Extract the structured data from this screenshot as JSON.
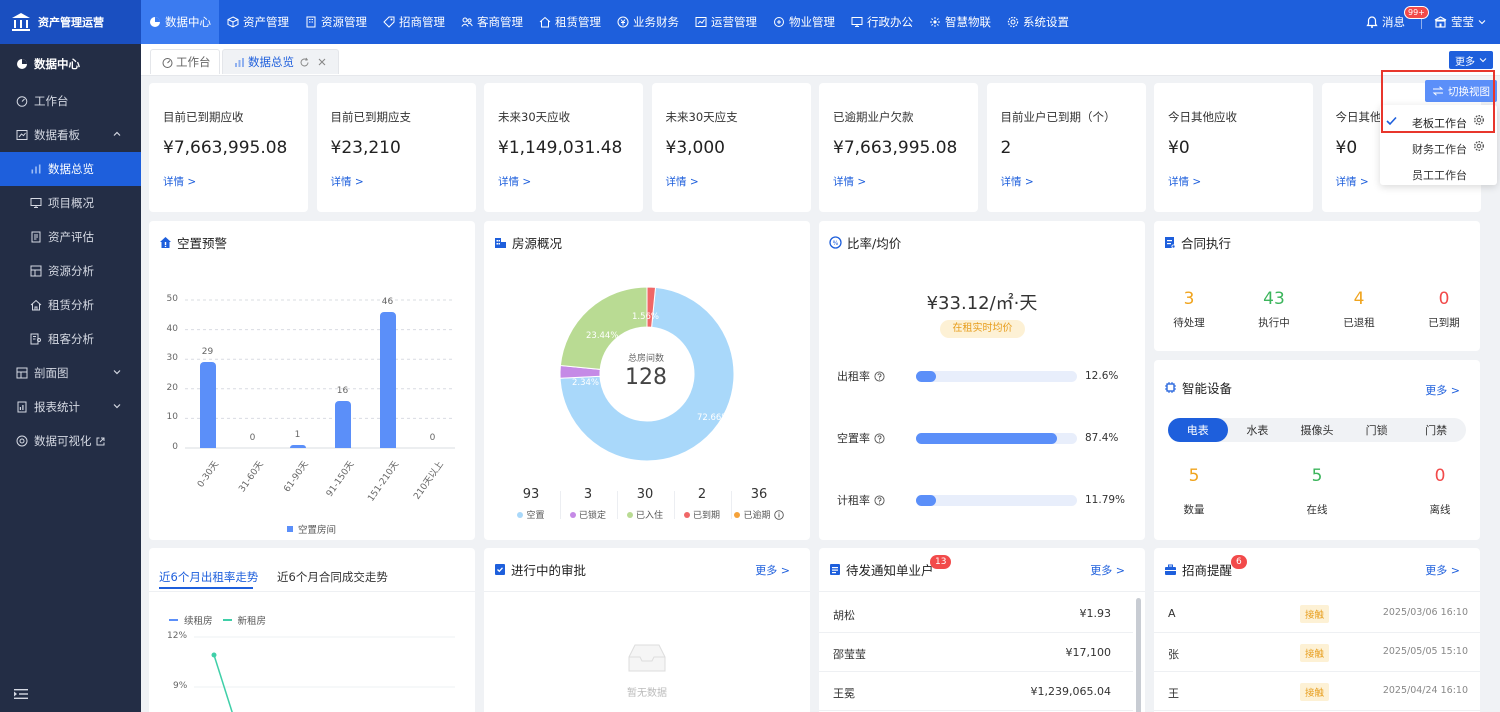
{
  "app": {
    "title": "资产管理运营"
  },
  "topnav": [
    {
      "label": "数据中心",
      "active": true,
      "icon": "pie-icon"
    },
    {
      "label": "资产管理",
      "icon": "cube-icon"
    },
    {
      "label": "资源管理",
      "icon": "building-icon"
    },
    {
      "label": "招商管理",
      "icon": "tag-icon"
    },
    {
      "label": "客商管理",
      "icon": "people-icon"
    },
    {
      "label": "租赁管理",
      "icon": "home-icon"
    },
    {
      "label": "业务财务",
      "icon": "coin-icon"
    },
    {
      "label": "运营管理",
      "icon": "chart-icon"
    },
    {
      "label": "物业管理",
      "icon": "tools-icon"
    },
    {
      "label": "行政办公",
      "icon": "monitor-icon"
    },
    {
      "label": "智慧物联",
      "icon": "iot-icon"
    },
    {
      "label": "系统设置",
      "icon": "gear-icon"
    }
  ],
  "header": {
    "messages_label": "消息",
    "messages_badge": "99+",
    "user_name": "莹莹"
  },
  "sidebar": {
    "section": "数据中心",
    "items": [
      {
        "label": "工作台",
        "icon": "dashboard-icon"
      },
      {
        "label": "数据看板",
        "icon": "board-icon",
        "expanded": true,
        "children": [
          {
            "label": "数据总览",
            "active": true,
            "icon": "bar-chart-icon"
          },
          {
            "label": "项目概况",
            "icon": "monitor-icon"
          },
          {
            "label": "资产评估",
            "icon": "doc-icon"
          },
          {
            "label": "资源分析",
            "icon": "layers-icon"
          },
          {
            "label": "租赁分析",
            "icon": "house-icon"
          },
          {
            "label": "租客分析",
            "icon": "person-doc-icon"
          }
        ]
      },
      {
        "label": "剖面图",
        "icon": "layers-icon",
        "caret": "down"
      },
      {
        "label": "报表统计",
        "icon": "report-icon",
        "caret": "down"
      },
      {
        "label": "数据可视化",
        "icon": "visual-icon",
        "external": true
      }
    ]
  },
  "tabs": [
    {
      "label": "工作台",
      "active": false
    },
    {
      "label": "数据总览",
      "active": true
    }
  ],
  "more_label": "更多",
  "stats": [
    {
      "label": "目前已到期应收",
      "value": "¥7,663,995.08",
      "link": "详情 >"
    },
    {
      "label": "目前已到期应支",
      "value": "¥23,210",
      "link": "详情 >"
    },
    {
      "label": "未来30天应收",
      "value": "¥1,149,031.48",
      "link": "详情 >"
    },
    {
      "label": "未来30天应支",
      "value": "¥3,000",
      "link": "详情 >"
    },
    {
      "label": "已逾期业户欠款",
      "value": "¥7,663,995.08",
      "link": "详情 >"
    },
    {
      "label": "目前业户已到期（个）",
      "value": "2",
      "link": "详情 >"
    },
    {
      "label": "今日其他应收",
      "value": "¥0",
      "link": "详情 >"
    },
    {
      "label": "今日其他",
      "value": "¥0",
      "link": "详情 >"
    }
  ],
  "vacancy": {
    "title": "空置预警",
    "legend": "空置房间",
    "chart_data": {
      "type": "bar",
      "categories": [
        "0-30天",
        "31-60天",
        "61-90天",
        "91-150天",
        "151-210天",
        "210天以上"
      ],
      "values": [
        29,
        0,
        1,
        16,
        46,
        0
      ],
      "ylim": [
        0,
        50
      ],
      "yticks": [
        0,
        10,
        20,
        30,
        40,
        50
      ],
      "grid": true,
      "legend_position": "bottom",
      "series": [
        {
          "name": "空置房间",
          "values": [
            29,
            0,
            1,
            16,
            46,
            0
          ]
        }
      ]
    }
  },
  "housing": {
    "title": "房源概况",
    "center_label": "总房间数",
    "center_value": "128",
    "chart_data": {
      "type": "pie",
      "categories": [
        "空置",
        "已锁定",
        "已入住",
        "已到期"
      ],
      "values": [
        72.66,
        2.34,
        23.44,
        1.56
      ],
      "labels": [
        "72.66%",
        "2.34%",
        "23.44%",
        "1.56%"
      ]
    },
    "stats": [
      {
        "value": "93",
        "label": "空置",
        "color": "#a9d8fa"
      },
      {
        "value": "3",
        "label": "已锁定",
        "color": "#c58ae6"
      },
      {
        "value": "30",
        "label": "已入住",
        "color": "#b9db93"
      },
      {
        "value": "2",
        "label": "已到期",
        "color": "#f06767"
      },
      {
        "value": "36",
        "label": "已逾期",
        "color": "#f5a23a"
      }
    ]
  },
  "rates": {
    "title": "比率/均价",
    "price": "¥33.12/㎡·天",
    "price_tag": "在租实时均价",
    "rows": [
      {
        "label": "出租率",
        "value": "12.6%",
        "fraction": 0.126
      },
      {
        "label": "空置率",
        "value": "87.4%",
        "fraction": 0.874
      },
      {
        "label": "计租率",
        "value": "11.79%",
        "fraction": 0.1179
      }
    ]
  },
  "contract": {
    "title": "合同执行",
    "items": [
      {
        "value": "3",
        "label": "待处理",
        "color": "#f0a41e"
      },
      {
        "value": "43",
        "label": "执行中",
        "color": "#3cb55c"
      },
      {
        "value": "4",
        "label": "已退租",
        "color": "#f0a41e"
      },
      {
        "value": "0",
        "label": "已到期",
        "color": "#f24a4a"
      }
    ]
  },
  "devices": {
    "title": "智能设备",
    "more": "更多 >",
    "tabs": [
      "电表",
      "水表",
      "摄像头",
      "门锁",
      "门禁"
    ],
    "items": [
      {
        "value": "5",
        "label": "数量",
        "color": "#f0a41e"
      },
      {
        "value": "5",
        "label": "在线",
        "color": "#3cb55c"
      },
      {
        "value": "0",
        "label": "离线",
        "color": "#f24a4a"
      }
    ]
  },
  "trend": {
    "tabs": [
      "近6个月出租率走势",
      "近6个月合同成交走势"
    ],
    "legend": [
      "续租房",
      "新租房"
    ],
    "yticks": [
      "12%",
      "9%"
    ],
    "chart_data": {
      "type": "line",
      "series": [
        {
          "name": "新租房",
          "values": [
            11
          ]
        },
        {
          "name": "续租房",
          "values": []
        }
      ]
    }
  },
  "approval": {
    "title": "进行中的审批",
    "more": "更多 >",
    "empty": "暂无数据"
  },
  "notice": {
    "title": "待发通知单业户",
    "badge": "13",
    "more": "更多 >",
    "rows": [
      {
        "name": "胡松",
        "amount": "¥1.93"
      },
      {
        "name": "邵莹莹",
        "amount": "¥17,100"
      },
      {
        "name": "王冕",
        "amount": "¥1,239,065.04"
      }
    ]
  },
  "leads": {
    "title": "招商提醒",
    "badge": "6",
    "more": "更多 >",
    "rows": [
      {
        "name": "A",
        "tag": "接触",
        "time": "2025/03/06 16:10"
      },
      {
        "name": "张",
        "tag": "接触",
        "time": "2025/05/05 15:10"
      },
      {
        "name": "王",
        "tag": "接触",
        "time": "2025/04/24 16:10"
      }
    ]
  },
  "switch_view": {
    "button": "切换视图",
    "options": [
      {
        "label": "老板工作台",
        "selected": true
      },
      {
        "label": "财务工作台",
        "selected": false
      },
      {
        "label": "员工工作台",
        "selected": false
      }
    ]
  },
  "colors": {
    "brand": "#1e5fdc",
    "sidebar": "#232d45",
    "bar": "#5b8ff9",
    "highlight": "#e8362c"
  }
}
